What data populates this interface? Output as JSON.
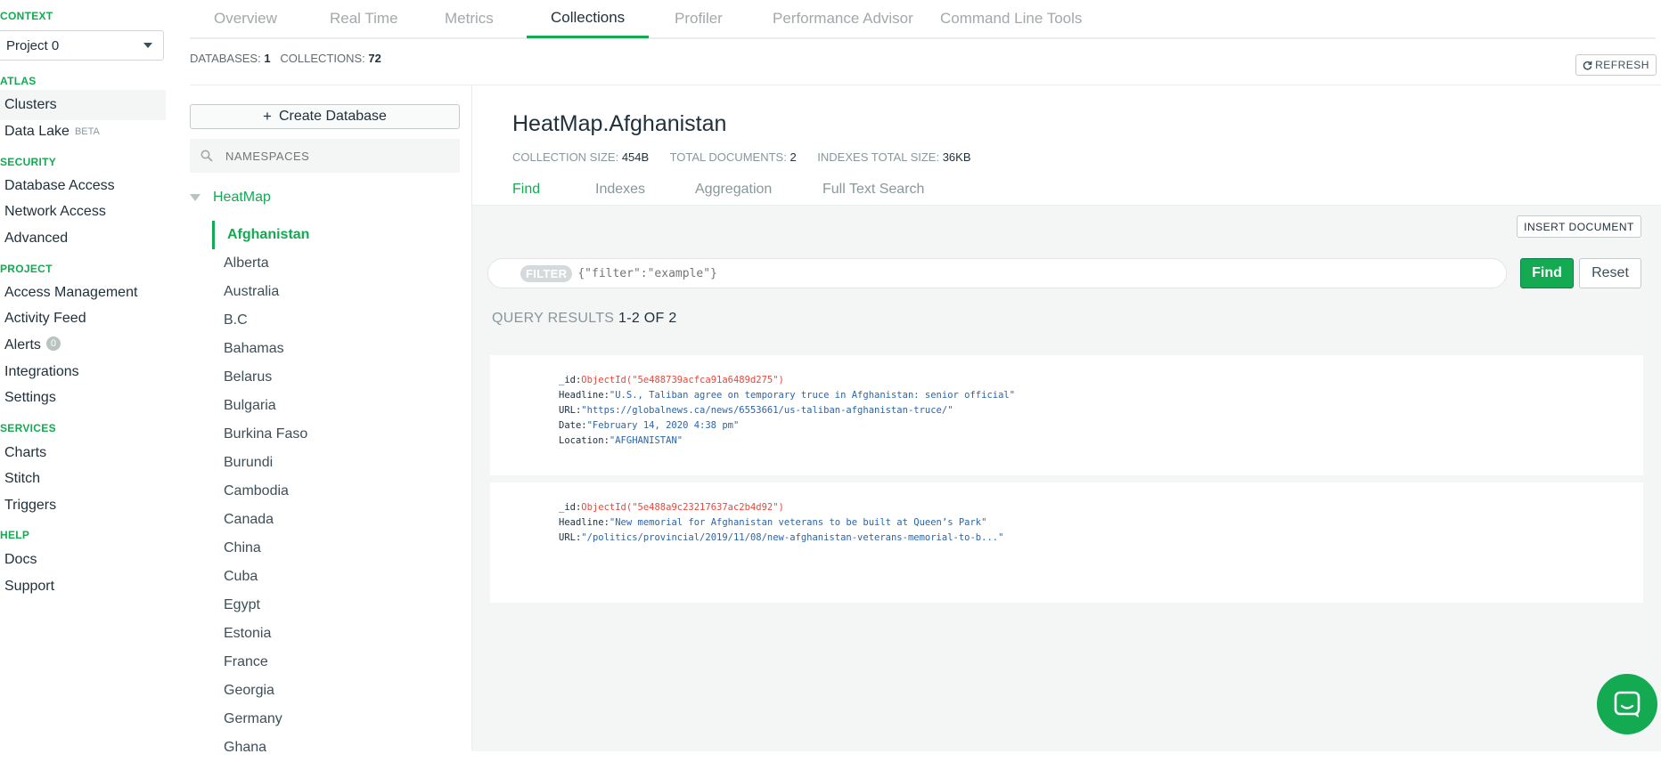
{
  "sidebar": {
    "context_label": "CONTEXT",
    "project": "Project 0",
    "atlas_label": "ATLAS",
    "atlas_items": [
      "Clusters",
      "Data Lake"
    ],
    "data_lake_badge": "BETA",
    "security_label": "SECURITY",
    "security_items": [
      "Database Access",
      "Network Access",
      "Advanced"
    ],
    "project_label": "PROJECT",
    "project_items": [
      "Access Management",
      "Activity Feed",
      "Alerts",
      "Integrations",
      "Settings"
    ],
    "alerts_count": "0",
    "services_label": "SERVICES",
    "services_items": [
      "Charts",
      "Stitch",
      "Triggers"
    ],
    "help_label": "HELP",
    "help_items": [
      "Docs",
      "Support"
    ]
  },
  "tabs": [
    "Overview",
    "Real Time",
    "Metrics",
    "Collections",
    "Profiler",
    "Performance Advisor",
    "Command Line Tools"
  ],
  "stats": {
    "databases_label": "DATABASES:",
    "databases": "1",
    "collections_label": "COLLECTIONS:",
    "collections": "72",
    "refresh_label": "REFRESH"
  },
  "left_panel": {
    "create_db_label": "Create Database",
    "search_placeholder": "NAMESPACES",
    "database": "HeatMap",
    "collections": [
      "Afghanistan",
      "Alberta",
      "Australia",
      "B.C",
      "Bahamas",
      "Belarus",
      "Bulgaria",
      "Burkina Faso",
      "Burundi",
      "Cambodia",
      "Canada",
      "China",
      "Cuba",
      "Egypt",
      "Estonia",
      "France",
      "Georgia",
      "Germany",
      "Ghana"
    ]
  },
  "collection": {
    "title": "HeatMap.Afghanistan",
    "size_label": "COLLECTION SIZE:",
    "size": "454B",
    "docs_label": "TOTAL DOCUMENTS:",
    "docs": "2",
    "index_label": "INDEXES TOTAL SIZE:",
    "index_size": "36KB",
    "subtabs": [
      "Find",
      "Indexes",
      "Aggregation",
      "Full Text Search"
    ]
  },
  "query": {
    "insert_label": "INSERT DOCUMENT",
    "filter_chip": "FILTER",
    "filter_placeholder": "{\"filter\":\"example\"}",
    "find_label": "Find",
    "reset_label": "Reset",
    "results_label": "QUERY RESULTS",
    "results_range": "1-2 OF 2"
  },
  "documents": [
    {
      "id_key": "_id:",
      "id_val": "ObjectId(\"5e488739acfca91a6489d275\")",
      "fields": [
        {
          "key": "Headline:",
          "val": "\"U.S., Taliban agree on temporary truce in Afghanistan: senior official\""
        },
        {
          "key": "URL:",
          "val": "\"https://globalnews.ca/news/6553661/us-taliban-afghanistan-truce/\""
        },
        {
          "key": "Date:",
          "val": "\"February 14, 2020 4:38 pm\""
        },
        {
          "key": "Location:",
          "val": "\"AFGHANISTAN\""
        }
      ]
    },
    {
      "id_key": "_id:",
      "id_val": "ObjectId(\"5e488a9c23217637ac2b4d92\")",
      "fields": [
        {
          "key": "Headline:",
          "val": "\"New memorial for Afghanistan veterans to be built at Queen’s Park\""
        },
        {
          "key": "URL:",
          "val": "\"/politics/provincial/2019/11/08/new-afghanistan-veterans-memorial-to-b...\""
        }
      ]
    }
  ],
  "colors": {
    "accent": "#13aa52",
    "text": "#21313c",
    "muted": "#89979b"
  }
}
